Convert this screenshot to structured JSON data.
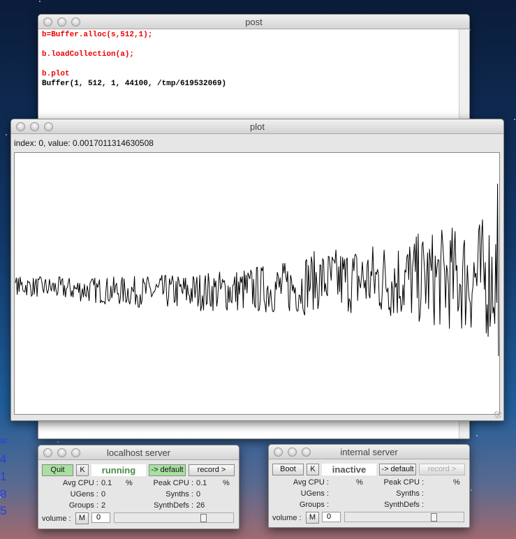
{
  "desktop": {
    "side_text": [
      "at",
      "4",
      "1",
      "8",
      "5"
    ]
  },
  "post": {
    "title": "post",
    "lines": [
      {
        "text": "b=Buffer.alloc(s,512,1);",
        "color": "red"
      },
      {
        "text": "",
        "color": "black"
      },
      {
        "text": "b.loadCollection(a);",
        "color": "red"
      },
      {
        "text": "",
        "color": "black"
      },
      {
        "text": "b.plot",
        "color": "red"
      },
      {
        "text": "Buffer(1, 512, 1, 44100, /tmp/619532069)",
        "color": "black"
      }
    ]
  },
  "plot": {
    "title": "plot",
    "index_label": "index: 0, value: 0.0017011314630508"
  },
  "chart_data": {
    "type": "line",
    "title": "plot",
    "samples": 512,
    "ylim": [
      -1,
      1
    ],
    "note": "noise waveform, amplitude increasing toward end"
  },
  "localhost": {
    "title": "localhost server",
    "boot_label": "Quit",
    "k_label": "K",
    "status": "running",
    "default_label": "-> default",
    "record_label": "record >",
    "avg_cpu_label": "Avg CPU :",
    "avg_cpu": "0.1",
    "pct": "%",
    "peak_cpu_label": "Peak CPU :",
    "peak_cpu": "0.1",
    "ugens_label": "UGens :",
    "ugens": "0",
    "synths_label": "Synths :",
    "synths": "0",
    "groups_label": "Groups :",
    "groups": "2",
    "synthdefs_label": "SynthDefs :",
    "synthdefs": "26",
    "volume_label": "volume :",
    "mute_label": "M",
    "volume": "0",
    "volume_level": 0.77
  },
  "internal": {
    "title": "internal server",
    "boot_label": "Boot",
    "k_label": "K",
    "status": "inactive",
    "default_label": "-> default",
    "record_label": "record >",
    "avg_cpu_label": "Avg CPU :",
    "avg_cpu": "",
    "pct": "%",
    "peak_cpu_label": "Peak CPU :",
    "peak_cpu": "",
    "ugens_label": "UGens :",
    "ugens": "",
    "synths_label": "Synths :",
    "synths": "",
    "groups_label": "Groups :",
    "groups": "",
    "synthdefs_label": "SynthDefs :",
    "synthdefs": "",
    "volume_label": "volume :",
    "mute_label": "M",
    "volume": "0",
    "volume_level": 0.77
  },
  "colors": {
    "running": "#4a8a4a",
    "inactive": "#555555",
    "green_button": "#a8e0a0"
  }
}
